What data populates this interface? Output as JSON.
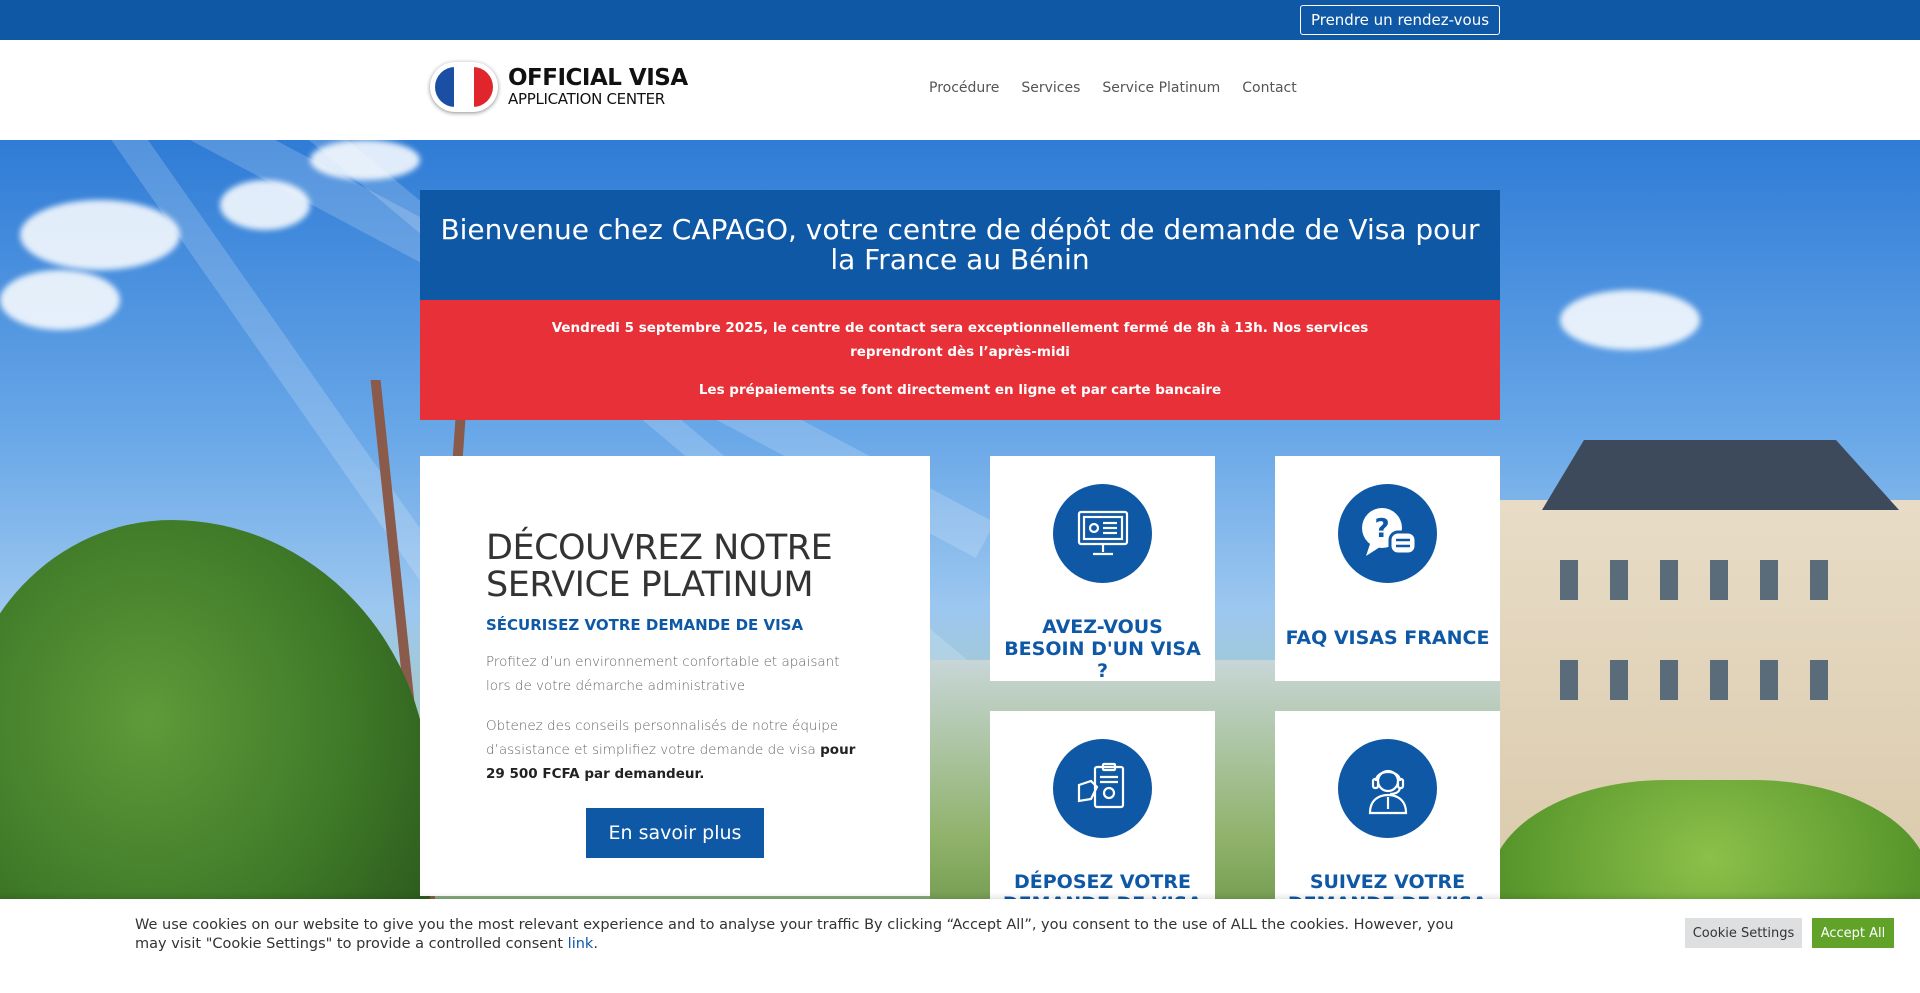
{
  "topbar": {
    "appointment_label": "Prendre un rendez-vous"
  },
  "logo": {
    "title": "OFFICIAL VISA",
    "subtitle": "APPLICATION CENTER"
  },
  "nav": {
    "items": [
      "Procédure",
      "Services",
      "Service Platinum",
      "Contact"
    ]
  },
  "welcome": {
    "title": "Bienvenue chez CAPAGO, votre centre de dépôt de demande de Visa pour la France au Bénin"
  },
  "alert": {
    "line1": "Vendredi 5 septembre 2025, le centre de contact sera exceptionnellement fermé de 8h à 13h. Nos services reprendront dès l’après-midi",
    "line2": "Les prépaiements se font directement en ligne et par carte bancaire"
  },
  "platinum": {
    "title": "DÉCOUVREZ NOTRE SERVICE PLATINUM",
    "subtitle": "SÉCURISEZ VOTRE DEMANDE DE VISA",
    "para1": "Profitez d’un environnement confortable et apaisant lors de votre démarche administrative",
    "para2": "Obtenez des conseils personnalisés de notre équipe d’assistance et simplifiez votre demande de visa",
    "para2_bold": "pour 29 500 FCFA par demandeur.",
    "button": "En savoir plus"
  },
  "cards": [
    {
      "title": "AVEZ-VOUS BESOIN D'UN VISA ?",
      "icon": "computer-settings-icon"
    },
    {
      "title": "FAQ VISAS FRANCE",
      "icon": "question-chat-icon"
    },
    {
      "title": "DÉPOSEZ VOTRE DEMANDE DE VISA",
      "icon": "document-hand-icon"
    },
    {
      "title": "SUIVEZ VOTRE DEMANDE DE VISA",
      "icon": "support-agent-icon"
    }
  ],
  "cookie": {
    "text": "We use cookies on our website to give you the most relevant experience and to analyse your traffic By clicking “Accept All”, you consent to the use of ALL the cookies. However, you may visit \"Cookie Settings\" to provide a controlled consent",
    "link": "link",
    "settings_label": "Cookie Settings",
    "accept_label": "Accept All"
  },
  "colors": {
    "brand_blue": "#0f58a6",
    "alert_red": "#e73038",
    "accept_green": "#61a229"
  }
}
